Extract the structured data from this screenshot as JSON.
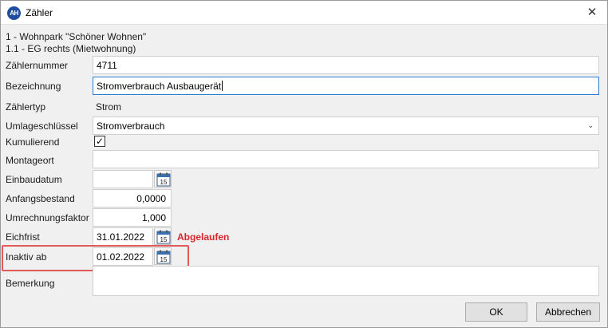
{
  "window": {
    "title": "Zähler",
    "app_icon_text": "AH",
    "close_glyph": "✕"
  },
  "context": {
    "property": "1 - Wohnpark \"Schöner Wohnen\"",
    "unit": "1.1 - EG rechts (Mietwohnung)"
  },
  "form": {
    "zaehlernummer": {
      "label": "Zählernummer",
      "value": "4711"
    },
    "bezeichnung": {
      "label": "Bezeichnung",
      "value": "Stromverbrauch Ausbaugerät"
    },
    "zaehlertyp": {
      "label": "Zählertyp",
      "value": "Strom"
    },
    "umlageschluessel": {
      "label": "Umlageschlüssel",
      "value": "Stromverbrauch"
    },
    "kumulierend": {
      "label": "Kumulierend",
      "checked": true,
      "check_glyph": "✓"
    },
    "montageort": {
      "label": "Montageort",
      "value": ""
    },
    "einbaudatum": {
      "label": "Einbaudatum",
      "value": ""
    },
    "anfangsbestand": {
      "label": "Anfangsbestand",
      "value": "0,0000"
    },
    "umrechnungsfaktor": {
      "label": "Umrechnungsfaktor",
      "value": "1,000"
    },
    "eichfrist": {
      "label": "Eichfrist",
      "value": "31.01.2022",
      "status": "Abgelaufen"
    },
    "inaktiv_ab": {
      "label": "Inaktiv ab",
      "value": "01.02.2022"
    },
    "bemerkung": {
      "label": "Bemerkung",
      "value": ""
    }
  },
  "calendar_icon_day": "15",
  "buttons": {
    "ok": "OK",
    "cancel": "Abbrechen"
  },
  "colors": {
    "status_expired": "#d9262c",
    "highlight_border": "#e05a5a",
    "app_icon_bg": "#1f4e9c"
  }
}
